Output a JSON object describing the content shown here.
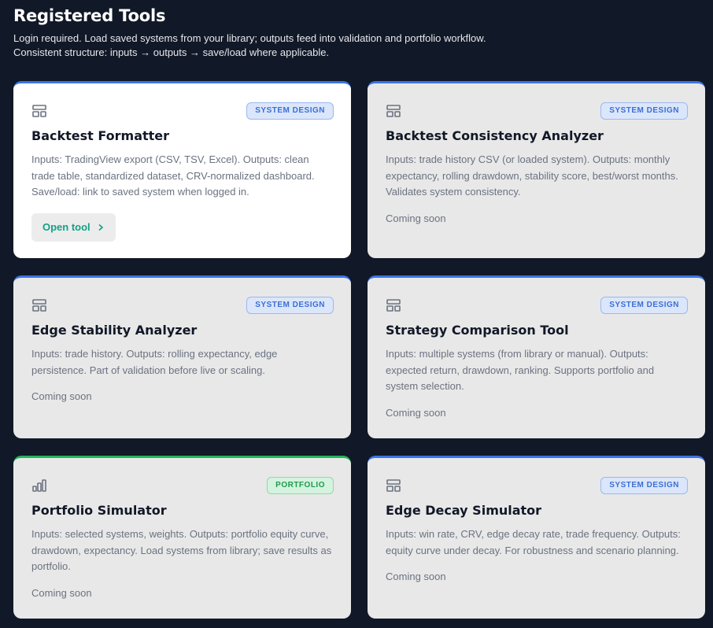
{
  "header": {
    "title": "Registered Tools",
    "subtitle": "Login required. Load saved systems from your library; outputs feed into validation and portfolio workflow. Consistent structure: inputs → outputs → save/load where applicable."
  },
  "colors": {
    "page_background": "#111827",
    "system_design_accent": "#3b73e6",
    "portfolio_accent": "#22b55a",
    "open_tool_text": "#12a286"
  },
  "cards": [
    {
      "icon": "layout-icon",
      "badge": "SYSTEM DESIGN",
      "title": "Backtest Formatter",
      "description": "Inputs: TradingView export (CSV, TSV, Excel). Outputs: clean trade table, standardized dataset, CRV-normalized dashboard. Save/load: link to saved system when logged in.",
      "action_label": "Open tool"
    },
    {
      "icon": "layout-icon",
      "badge": "SYSTEM DESIGN",
      "title": "Backtest Consistency Analyzer",
      "description": "Inputs: trade history CSV (or loaded system). Outputs: monthly expectancy, rolling drawdown, stability score, best/worst months. Validates system consistency.",
      "status": "Coming soon"
    },
    {
      "icon": "layout-icon",
      "badge": "SYSTEM DESIGN",
      "title": "Edge Stability Analyzer",
      "description": "Inputs: trade history. Outputs: rolling expectancy, edge persistence. Part of validation before live or scaling.",
      "status": "Coming soon"
    },
    {
      "icon": "layout-icon",
      "badge": "SYSTEM DESIGN",
      "title": "Strategy Comparison Tool",
      "description": "Inputs: multiple systems (from library or manual). Outputs: expected return, drawdown, ranking. Supports portfolio and system selection.",
      "status": "Coming soon"
    },
    {
      "icon": "bar-chart-icon",
      "badge": "PORTFOLIO",
      "title": "Portfolio Simulator",
      "description": "Inputs: selected systems, weights. Outputs: portfolio equity curve, drawdown, expectancy. Load systems from library; save results as portfolio.",
      "status": "Coming soon"
    },
    {
      "icon": "layout-icon",
      "badge": "SYSTEM DESIGN",
      "title": "Edge Decay Simulator",
      "description": "Inputs: win rate, CRV, edge decay rate, trade frequency. Outputs: equity curve under decay. For robustness and scenario planning.",
      "status": "Coming soon"
    }
  ]
}
